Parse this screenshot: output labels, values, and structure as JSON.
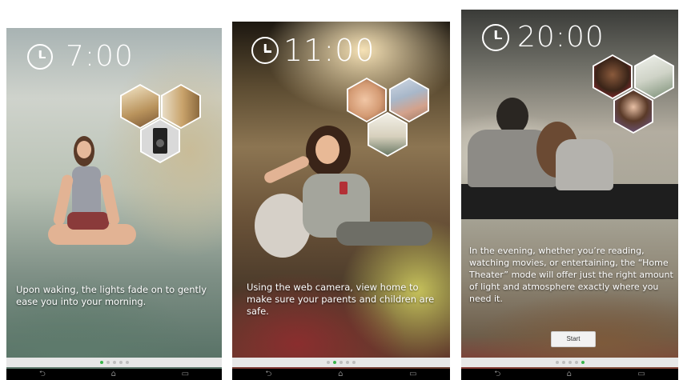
{
  "screens": [
    {
      "time": "7:00",
      "caption": "Upon waking, the lights fade on to gently ease you into your morning.",
      "page_dots": 5,
      "active_dot": 0,
      "hex_icons": [
        "ceiling-light-icon",
        "curtain-icon",
        "speaker-icon"
      ]
    },
    {
      "time": "11:00",
      "caption": "Using the web camera, view home to make sure your parents and children are safe.",
      "page_dots": 5,
      "active_dot": 1,
      "hex_icons": [
        "baby-photo-icon",
        "elderly-couple-icon",
        "living-room-icon"
      ]
    },
    {
      "time": "20:00",
      "caption": "In the evening, whether you’re reading, watching movies, or entertaining, the “Home Theater” mode will offer just the right amount of light and atmosphere exactly where you need it.",
      "start_button": "Start",
      "page_dots": 5,
      "active_dot": 4,
      "hex_icons": [
        "woman-smiling-icon",
        "lamp-room-icon",
        "woman-headset-icon"
      ]
    }
  ],
  "system_bar": {
    "back": "back-icon",
    "home": "home-icon",
    "recents": "recents-icon"
  },
  "colors": {
    "active_dot": "#39b54a",
    "inactive_dot": "#bdbdbd",
    "dots_bar": "#e7e7e7",
    "system_bar": "#000000"
  }
}
